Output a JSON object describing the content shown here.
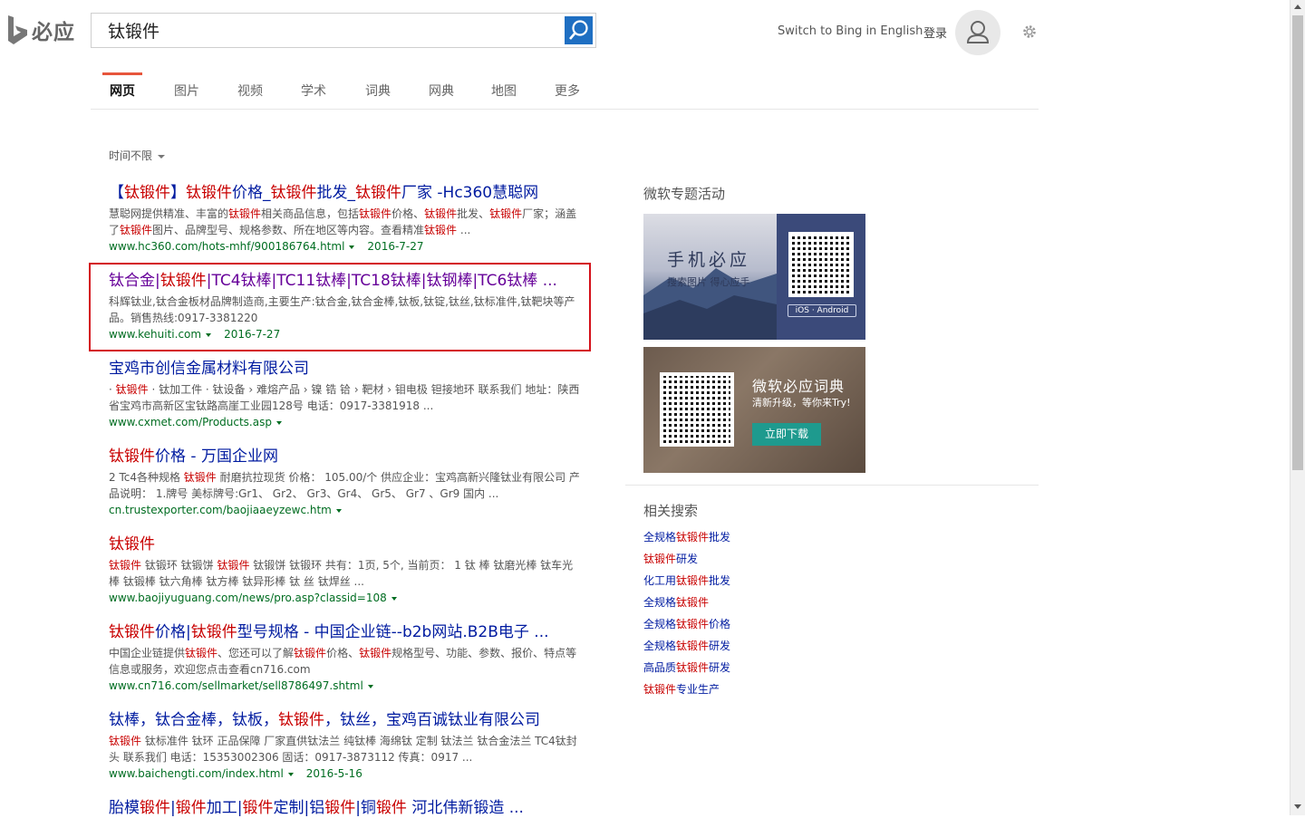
{
  "header": {
    "logo_text": "必应",
    "search_value": "钛锻件",
    "switch_lang": "Switch to Bing in English",
    "login": "登录"
  },
  "nav": {
    "tabs": [
      "网页",
      "图片",
      "视频",
      "学术",
      "词典",
      "网典",
      "地图",
      "更多"
    ],
    "active_index": 0
  },
  "filter": {
    "time_label": "时间不限"
  },
  "results": [
    {
      "title_parts": [
        [
          "【",
          0
        ],
        [
          "钛锻件",
          1
        ],
        [
          "】",
          0
        ],
        [
          "钛锻件",
          1
        ],
        [
          "价格_",
          0
        ],
        [
          "钛锻件",
          1
        ],
        [
          "批发_",
          0
        ],
        [
          "钛锻件",
          1
        ],
        [
          "厂家 -Hc360慧聪网",
          0
        ]
      ],
      "snippet_parts": [
        [
          "慧聪网提供精准、丰富的",
          0
        ],
        [
          "钛锻件",
          1
        ],
        [
          "相关商品信息，包括",
          0
        ],
        [
          "钛锻件",
          1
        ],
        [
          "价格、",
          0
        ],
        [
          "钛锻件",
          1
        ],
        [
          "批发、",
          0
        ],
        [
          "钛锻件",
          1
        ],
        [
          "厂家；涵盖了",
          0
        ],
        [
          "钛锻件",
          1
        ],
        [
          "图片、品牌型号、规格参数、所在地区等内容。查看精准",
          0
        ],
        [
          "钛锻件",
          1
        ],
        [
          " ...",
          0
        ]
      ],
      "url": "www.hc360.com/hots-mhf/900186764.html",
      "date": "2016-7-27",
      "visited": false
    },
    {
      "title_parts": [
        [
          "钛合金|",
          0
        ],
        [
          "钛锻件",
          1
        ],
        [
          "|TC4钛棒|TC11钛棒|TC18钛棒|钛钢棒|TC6钛棒 ...",
          0
        ]
      ],
      "snippet_parts": [
        [
          "科辉钛业,钛合金板材品牌制造商,主要生产:钛合金,钛合金棒,钛板,钛锭,钛丝,钛标准件,钛靶块等产品。销售热线:0917-3381220",
          0
        ]
      ],
      "url": "www.kehuiti.com",
      "date": "2016-7-27",
      "visited": true
    },
    {
      "title_parts": [
        [
          "宝鸡市创信金属材料有限公司",
          0
        ]
      ],
      "snippet_parts": [
        [
          "· ",
          0
        ],
        [
          "钛锻件",
          1
        ],
        [
          " · 钛加工件 · 钛设备 › 难熔产品 › 镍 锆 铪 › 靶材 › 钼电极 钽接地环 联系我们 地址：陕西省宝鸡市高新区宝钛路高崖工业园128号 电话：0917-3381918 ...",
          0
        ]
      ],
      "url": "www.cxmet.com/Products.asp",
      "date": "",
      "visited": false
    },
    {
      "title_parts": [
        [
          "钛锻件",
          1
        ],
        [
          "价格 - 万国企业网",
          0
        ]
      ],
      "snippet_parts": [
        [
          "2 Tc4各种规格 ",
          0
        ],
        [
          "钛锻件",
          1
        ],
        [
          " 耐磨抗拉现货 价格： 105.00/个 供应企业：宝鸡高新兴隆钛业有限公司 产品说明： 1.牌号 美标牌号:Gr1、 Gr2、 Gr3、Gr4、 Gr5、 Gr7 、Gr9 国内 ...",
          0
        ]
      ],
      "url": "cn.trustexporter.com/baojiaaeyzewc.htm",
      "date": "",
      "visited": false
    },
    {
      "title_parts": [
        [
          "钛锻件",
          1
        ]
      ],
      "snippet_parts": [
        [
          "钛锻件",
          1
        ],
        [
          " 钛锻环 钛锻饼 ",
          0
        ],
        [
          "钛锻件",
          1
        ],
        [
          " 钛锻饼 钛锻环 共有：1页, 5个, 当前页： 1 钛 棒 钛磨光棒 钛车光棒 钛锻棒 钛六角棒 钛方棒 钛异形棒 钛 丝 钛焊丝 ...",
          0
        ]
      ],
      "url": "www.baojiyuguang.com/news/pro.asp?classid=108",
      "date": "",
      "visited": false
    },
    {
      "title_parts": [
        [
          "钛锻件",
          1
        ],
        [
          "价格|",
          0
        ],
        [
          "钛锻件",
          1
        ],
        [
          "型号规格 - 中国企业链--b2b网站.B2B电子 ...",
          0
        ]
      ],
      "snippet_parts": [
        [
          "中国企业链提供",
          0
        ],
        [
          "钛锻件",
          1
        ],
        [
          "、您还可以了解",
          0
        ],
        [
          "钛锻件",
          1
        ],
        [
          "价格、",
          0
        ],
        [
          "钛锻件",
          1
        ],
        [
          "规格型号、功能、参数、报价、特点等信息或服务，欢迎您点击查看cn716.com",
          0
        ]
      ],
      "url": "www.cn716.com/sellmarket/sell8786497.shtml",
      "date": "",
      "visited": false
    },
    {
      "title_parts": [
        [
          "钛棒，钛合金棒，钛板，",
          0
        ],
        [
          "钛锻件",
          1
        ],
        [
          "，钛丝，宝鸡百诚钛业有限公司",
          0
        ]
      ],
      "snippet_parts": [
        [
          "钛锻件",
          1
        ],
        [
          " 钛标准件 钛环 正品保障 厂家直供钛法兰 纯钛棒 海绵钛 定制 钛法兰 钛合金法兰 TC4钛封头 联系我们 电话：15353002306 固话：0917-3873112 传真：0917 ...",
          0
        ]
      ],
      "url": "www.baichengti.com/index.html",
      "date": "2016-5-16",
      "visited": false
    },
    {
      "title_parts": [
        [
          "胎模",
          0
        ],
        [
          "锻件",
          1
        ],
        [
          "|",
          0
        ],
        [
          "锻件",
          1
        ],
        [
          "加工|",
          0
        ],
        [
          "锻件",
          1
        ],
        [
          "定制|铝",
          0
        ],
        [
          "锻件",
          1
        ],
        [
          "|铜",
          0
        ],
        [
          "锻件",
          1
        ],
        [
          " 河北伟新锻造 ...",
          0
        ]
      ],
      "snippet_parts": [],
      "url": "",
      "date": "",
      "visited": false
    }
  ],
  "sidebar": {
    "promo_section_title": "微软专题活动",
    "promo1": {
      "title": "手机必应",
      "subtitle": "搜索图片 得心应手",
      "badge": "iOS · Android"
    },
    "promo2": {
      "title": "微软必应词典",
      "subtitle": "清新升级，等你来Try!",
      "button": "立即下载"
    },
    "related_title": "相关搜索",
    "related": [
      [
        [
          "全规格",
          0
        ],
        [
          "钛锻件",
          1
        ],
        [
          "批发",
          0
        ]
      ],
      [
        [
          "钛锻件",
          1
        ],
        [
          "研发",
          0
        ]
      ],
      [
        [
          "化工用",
          0
        ],
        [
          "钛锻件",
          1
        ],
        [
          "批发",
          0
        ]
      ],
      [
        [
          "全规格",
          0
        ],
        [
          "钛锻件",
          1
        ]
      ],
      [
        [
          "全规格",
          0
        ],
        [
          "钛锻件",
          1
        ],
        [
          "价格",
          0
        ]
      ],
      [
        [
          "全规格",
          0
        ],
        [
          "钛锻件",
          1
        ],
        [
          "研发",
          0
        ]
      ],
      [
        [
          "高品质",
          0
        ],
        [
          "钛锻件",
          1
        ],
        [
          "研发",
          0
        ]
      ],
      [
        [
          "钛锻件",
          1
        ],
        [
          "专业生产",
          0
        ]
      ]
    ]
  },
  "colors": {
    "link": "#001ba0",
    "visited": "#660099",
    "highlight_term": "#c80000",
    "url_green": "#006d21",
    "tab_underline": "#e7553b",
    "annotation_box": "#d4111a"
  }
}
